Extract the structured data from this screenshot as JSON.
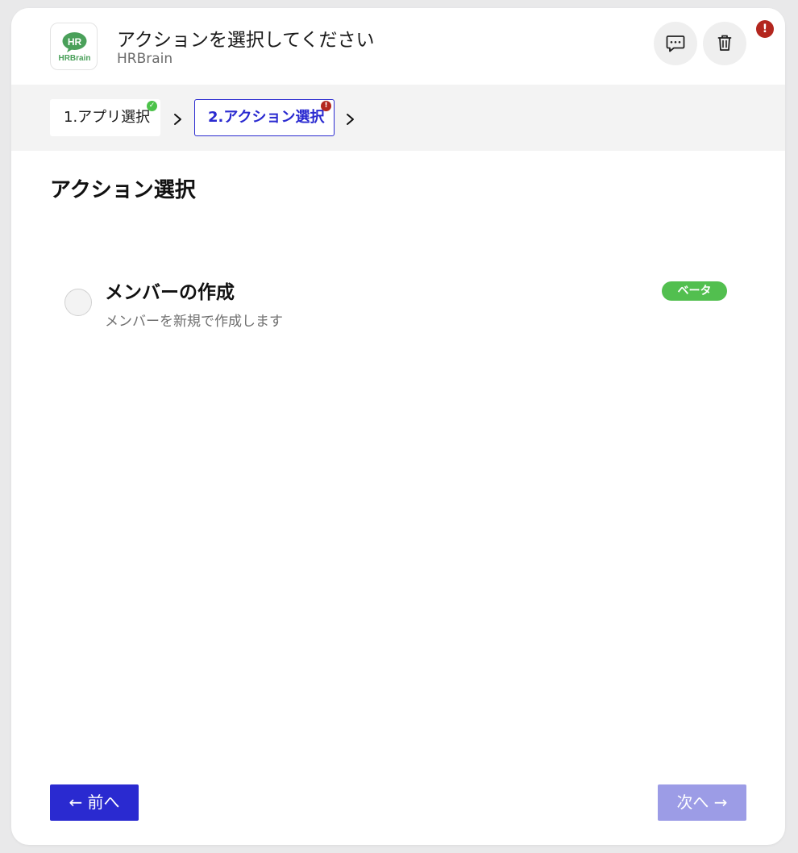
{
  "header": {
    "title": "アクションを選択してください",
    "subtitle": "HRBrain",
    "logo": {
      "badge_text": "HR",
      "wordmark": "HRBrain",
      "color": "#4aa05a"
    },
    "error_indicator": "!"
  },
  "steps": [
    {
      "label": "1.アプリ選択",
      "status": "complete",
      "badge": "✓"
    },
    {
      "label": "2.アクション選択",
      "status": "error",
      "badge": "!",
      "active": true
    }
  ],
  "section": {
    "title": "アクション選択"
  },
  "actions": [
    {
      "title": "メンバーの作成",
      "description": "メンバーを新規で作成します",
      "badge": "ベータ",
      "selected": false
    }
  ],
  "footer": {
    "prev_label": "← 前へ",
    "next_label": "次へ →"
  },
  "colors": {
    "primary": "#2a2ad0",
    "primary_disabled": "#9c9ce6",
    "success": "#52bf4f",
    "error": "#b3261e",
    "steps_bg": "#f3f3f3"
  },
  "icons": {
    "comment": "comment-icon",
    "trash": "trash-icon",
    "chevron": "chevron-right-icon"
  }
}
